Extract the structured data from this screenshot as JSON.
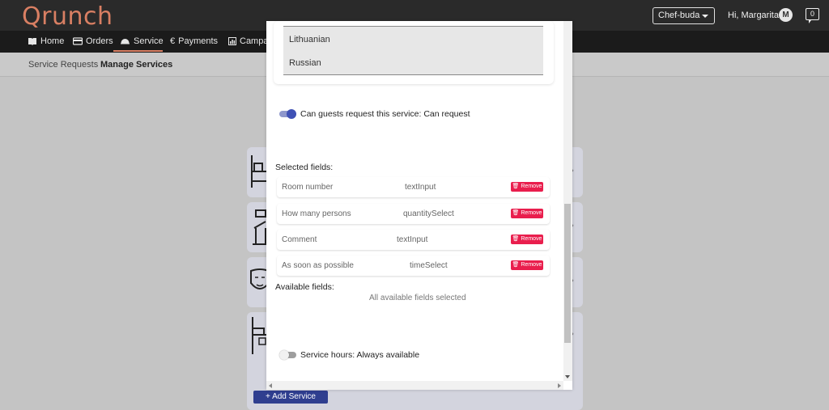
{
  "header": {
    "logo": "Qrunch",
    "venue_select": "Chef-buda",
    "greeting": "Hi, Margarita",
    "avatar_letter": "M",
    "messages_count": "0"
  },
  "nav": {
    "items": [
      {
        "label": "Home",
        "icon": "book-icon"
      },
      {
        "label": "Orders",
        "icon": "card-icon"
      },
      {
        "label": "Service",
        "icon": "cloche-icon"
      },
      {
        "label": "Payments",
        "icon": "euro-icon"
      },
      {
        "label": "Campa",
        "icon": "chart-icon"
      }
    ],
    "active": "Service"
  },
  "subnav": {
    "items": [
      "Service Requests",
      "Manage Services"
    ],
    "active": "Manage Services"
  },
  "background": {
    "add_service_label": "+ Add Service"
  },
  "modal": {
    "languages": [
      "Lithuanian",
      "Russian"
    ],
    "guest_request_toggle": {
      "label": "Can guests request this service: Can request",
      "on": true
    },
    "selected_fields_title": "Selected fields:",
    "selected_fields": [
      {
        "name": "Room number",
        "type": "textInput",
        "action": "Remove"
      },
      {
        "name": "How many persons",
        "type": "quantitySelect",
        "action": "Remove"
      },
      {
        "name": "Comment",
        "type": "textInput",
        "action": "Remove"
      },
      {
        "name": "As soon as possible",
        "type": "timeSelect",
        "action": "Remove"
      }
    ],
    "available_fields_title": "Available fields:",
    "available_fields_empty": "All available fields selected",
    "service_hours_toggle": {
      "label": "Service hours: Always available",
      "on": false
    }
  },
  "colors": {
    "brand": "#d97f63",
    "primary": "#3f51b5",
    "danger": "#e91e4d"
  }
}
